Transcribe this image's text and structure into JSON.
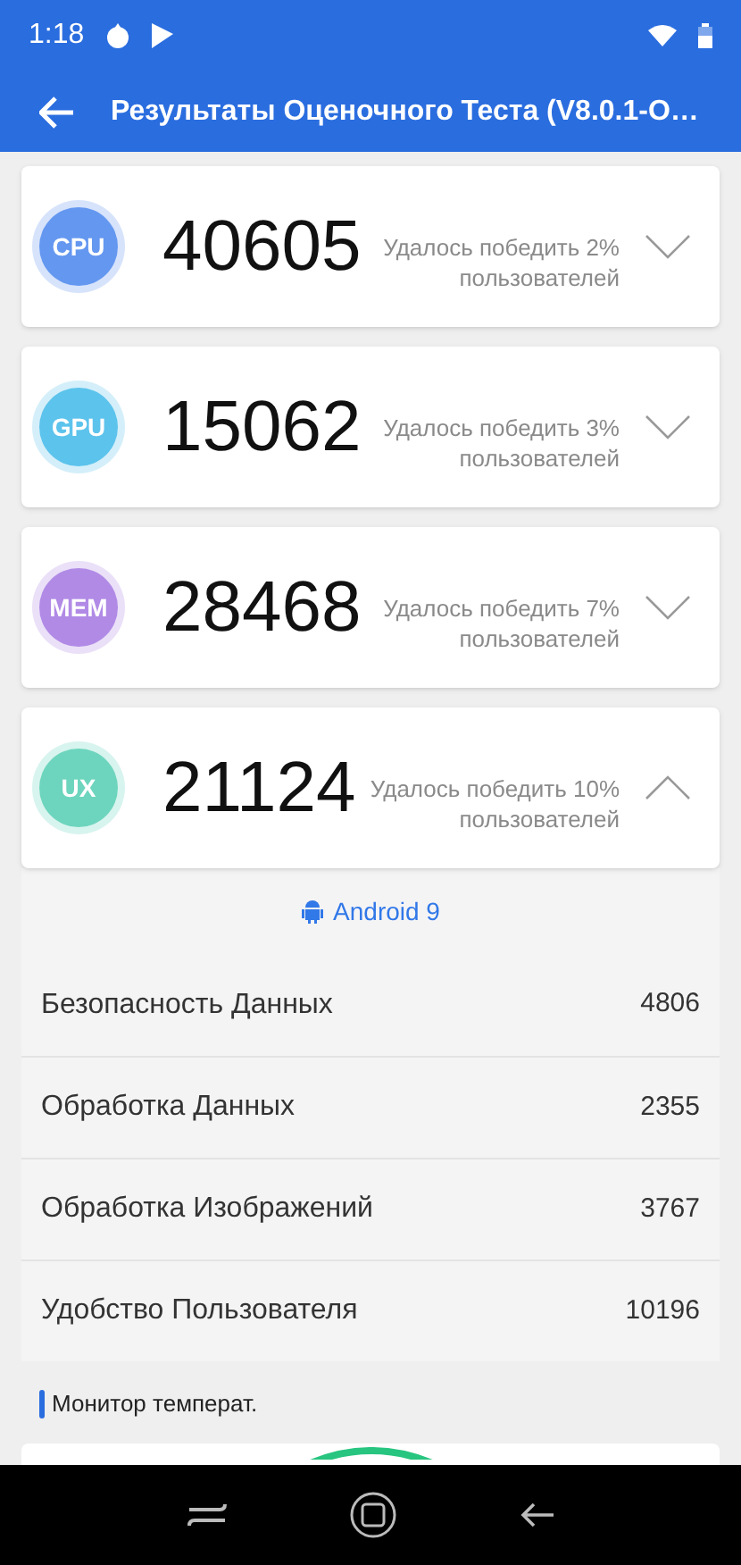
{
  "status_bar": {
    "time": "1:18"
  },
  "app_bar": {
    "title": "Результаты Оценочного Теста (V8.0.1-O…"
  },
  "scores": [
    {
      "badge": "CPU",
      "color": "#6497f0",
      "score": "40605",
      "note_line_1": "Удалось победить 2%",
      "note_line_2": "пользователей",
      "expanded": false
    },
    {
      "badge": "GPU",
      "color": "#5cc3ec",
      "score": "15062",
      "note_line_1": "Удалось победить 3%",
      "note_line_2": "пользователей",
      "expanded": false
    },
    {
      "badge": "MEM",
      "color": "#b18ae6",
      "score": "28468",
      "note_line_1": "Удалось победить 7%",
      "note_line_2": "пользователей",
      "expanded": false
    },
    {
      "badge": "UX",
      "color": "#6dd5be",
      "score": "21124",
      "note_line_1": "Удалось победить 10%",
      "note_line_2": "пользователей",
      "expanded": true
    }
  ],
  "details": {
    "platform": "Android 9",
    "rows": [
      {
        "label": "Безопасность Данных",
        "value": "4806"
      },
      {
        "label": "Обработка Данных",
        "value": "2355"
      },
      {
        "label": "Обработка Изображений",
        "value": "3767"
      },
      {
        "label": "Удобство Пользователя",
        "value": "10196"
      }
    ]
  },
  "section": {
    "title": "Монитор температ."
  }
}
